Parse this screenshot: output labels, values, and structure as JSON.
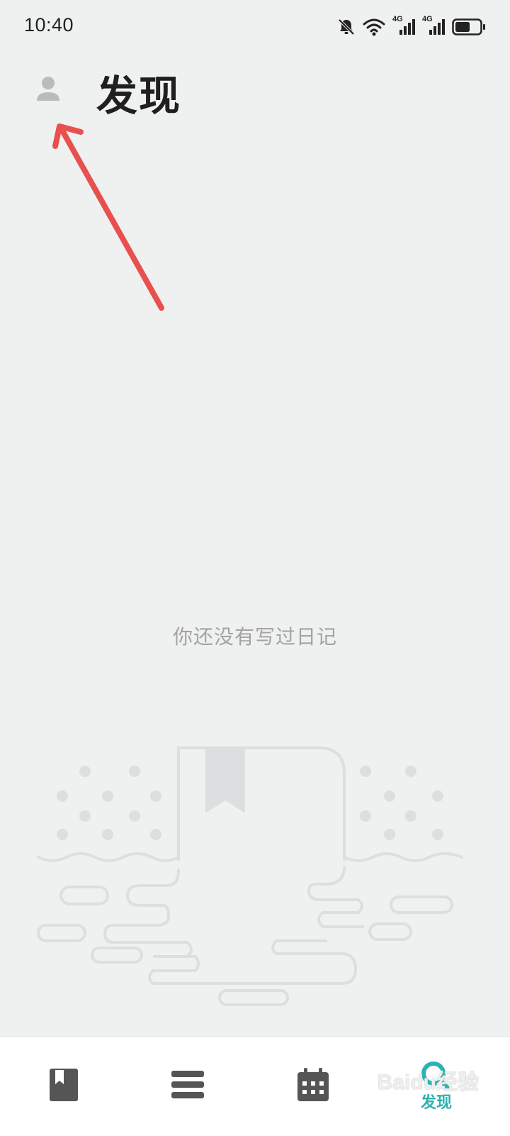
{
  "status_bar": {
    "time": "10:40",
    "icons": [
      "bell-off-icon",
      "wifi-icon",
      "signal-4g-icon",
      "signal-4g-icon",
      "battery-icon"
    ],
    "network_label_1": "4G",
    "network_label_2": "4G",
    "battery_level": 0.6
  },
  "header": {
    "title": "发现",
    "avatar_icon": "user-icon"
  },
  "annotation": {
    "color": "#e8504f",
    "icon": "red-arrow-pointing-at-avatar"
  },
  "empty_state": {
    "message": "你还没有写过日记",
    "illustration_icon": "bookmark-book-illustration"
  },
  "bottom_nav": {
    "items": [
      {
        "icon": "diary-book-icon",
        "label": "",
        "active": false
      },
      {
        "icon": "menu-list-icon",
        "label": "",
        "active": false
      },
      {
        "icon": "calendar-icon",
        "label": "",
        "active": false
      },
      {
        "icon": "search-icon",
        "label": "发现",
        "active": true
      }
    ],
    "accent_color": "#2ab3b1",
    "inactive_color": "#555555"
  },
  "watermark": {
    "text": "Baidu经验"
  }
}
